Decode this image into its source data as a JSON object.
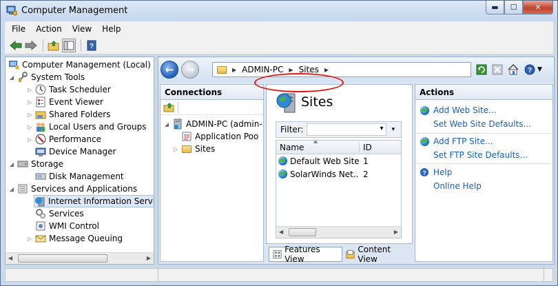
{
  "window": {
    "title": "Computer Management",
    "controls": [
      "minimize",
      "maximize",
      "close"
    ]
  },
  "menu": [
    "File",
    "Action",
    "View",
    "Help"
  ],
  "tree": {
    "items": [
      {
        "label": "Computer Management (Local)",
        "arrow": "",
        "icon": "computer-management-icon"
      },
      {
        "label": "System Tools",
        "arrow": "◢",
        "icon": "system-tools-icon"
      },
      {
        "label": "Task Scheduler",
        "arrow": "▷",
        "icon": "clock-icon"
      },
      {
        "label": "Event Viewer",
        "arrow": "▷",
        "icon": "event-viewer-icon"
      },
      {
        "label": "Shared Folders",
        "arrow": "▷",
        "icon": "shared-folders-icon"
      },
      {
        "label": "Local Users and Groups",
        "arrow": "▷",
        "icon": "users-icon"
      },
      {
        "label": "Performance",
        "arrow": "▷",
        "icon": "performance-icon"
      },
      {
        "label": "Device Manager",
        "arrow": "",
        "icon": "device-manager-icon"
      },
      {
        "label": "Storage",
        "arrow": "◢",
        "icon": "storage-icon"
      },
      {
        "label": "Disk Management",
        "arrow": "",
        "icon": "disk-icon"
      },
      {
        "label": "Services and Applications",
        "arrow": "◢",
        "icon": "services-apps-icon"
      },
      {
        "label": "Internet Information Services",
        "arrow": "",
        "icon": "iis-icon"
      },
      {
        "label": "Services",
        "arrow": "",
        "icon": "services-icon"
      },
      {
        "label": "WMI Control",
        "arrow": "",
        "icon": "wmi-icon"
      },
      {
        "label": "Message Queuing",
        "arrow": "▷",
        "icon": "message-queue-icon"
      }
    ]
  },
  "address": {
    "segments": [
      "ADMIN-PC",
      "Sites"
    ],
    "separator": "▶"
  },
  "connections": {
    "header": "Connections",
    "server": "ADMIN-PC (admin-",
    "app_pools": "Application Poo",
    "sites": "Sites"
  },
  "center": {
    "title": "Sites",
    "filter_label": "Filter:",
    "columns": [
      "Name",
      "ID"
    ],
    "rows": [
      {
        "name": "Default Web Site",
        "id": "1"
      },
      {
        "name": "SolarWinds Net...",
        "id": "2"
      }
    ],
    "tabs": [
      "Features View",
      "Content View"
    ]
  },
  "actions": {
    "header": "Actions",
    "items": [
      "Add Web Site...",
      "Set Web Site Defaults...",
      "Add FTP Site...",
      "Set FTP Site Defaults...",
      "Help",
      "Online Help"
    ]
  },
  "colors": {
    "link": "#1a5fb4",
    "highlight_circle": "#e01515"
  }
}
